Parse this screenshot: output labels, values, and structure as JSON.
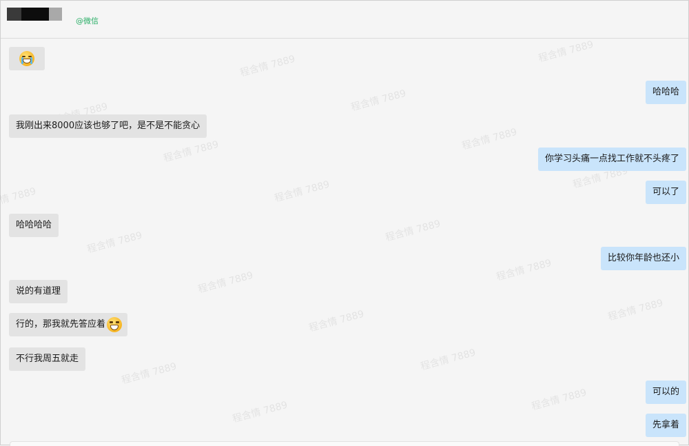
{
  "header": {
    "contact_source": "@微信",
    "avatar_colors": [
      "#3a3a3a",
      "#0d0d0d",
      "#a9a9a9"
    ]
  },
  "watermark_text": "程含情 7889",
  "messages": [
    {
      "side": "in",
      "text": "",
      "emoji": "crying-emoji"
    },
    {
      "side": "out",
      "text": "哈哈哈"
    },
    {
      "side": "in",
      "text": "我刚出来8000应该也够了吧，是不是不能贪心"
    },
    {
      "side": "out",
      "text": "你学习头痛一点找工作就不头疼了"
    },
    {
      "side": "out",
      "text": "可以了"
    },
    {
      "side": "in",
      "text": "哈哈哈哈"
    },
    {
      "side": "out",
      "text": "比较你年龄也还小"
    },
    {
      "side": "in",
      "text": "说的有道理"
    },
    {
      "side": "in",
      "text": "行的，那我就先答应着",
      "emoji": "grinning-emoji"
    },
    {
      "side": "in",
      "text": "不行我周五就走"
    },
    {
      "side": "out",
      "text": "可以的"
    },
    {
      "side": "out",
      "text": "先拿着"
    }
  ],
  "colors": {
    "incoming_bubble": "#e3e3e3",
    "outgoing_bubble": "#c9e4fb",
    "wechat_green": "#2aae67",
    "background": "#f5f5f5"
  }
}
